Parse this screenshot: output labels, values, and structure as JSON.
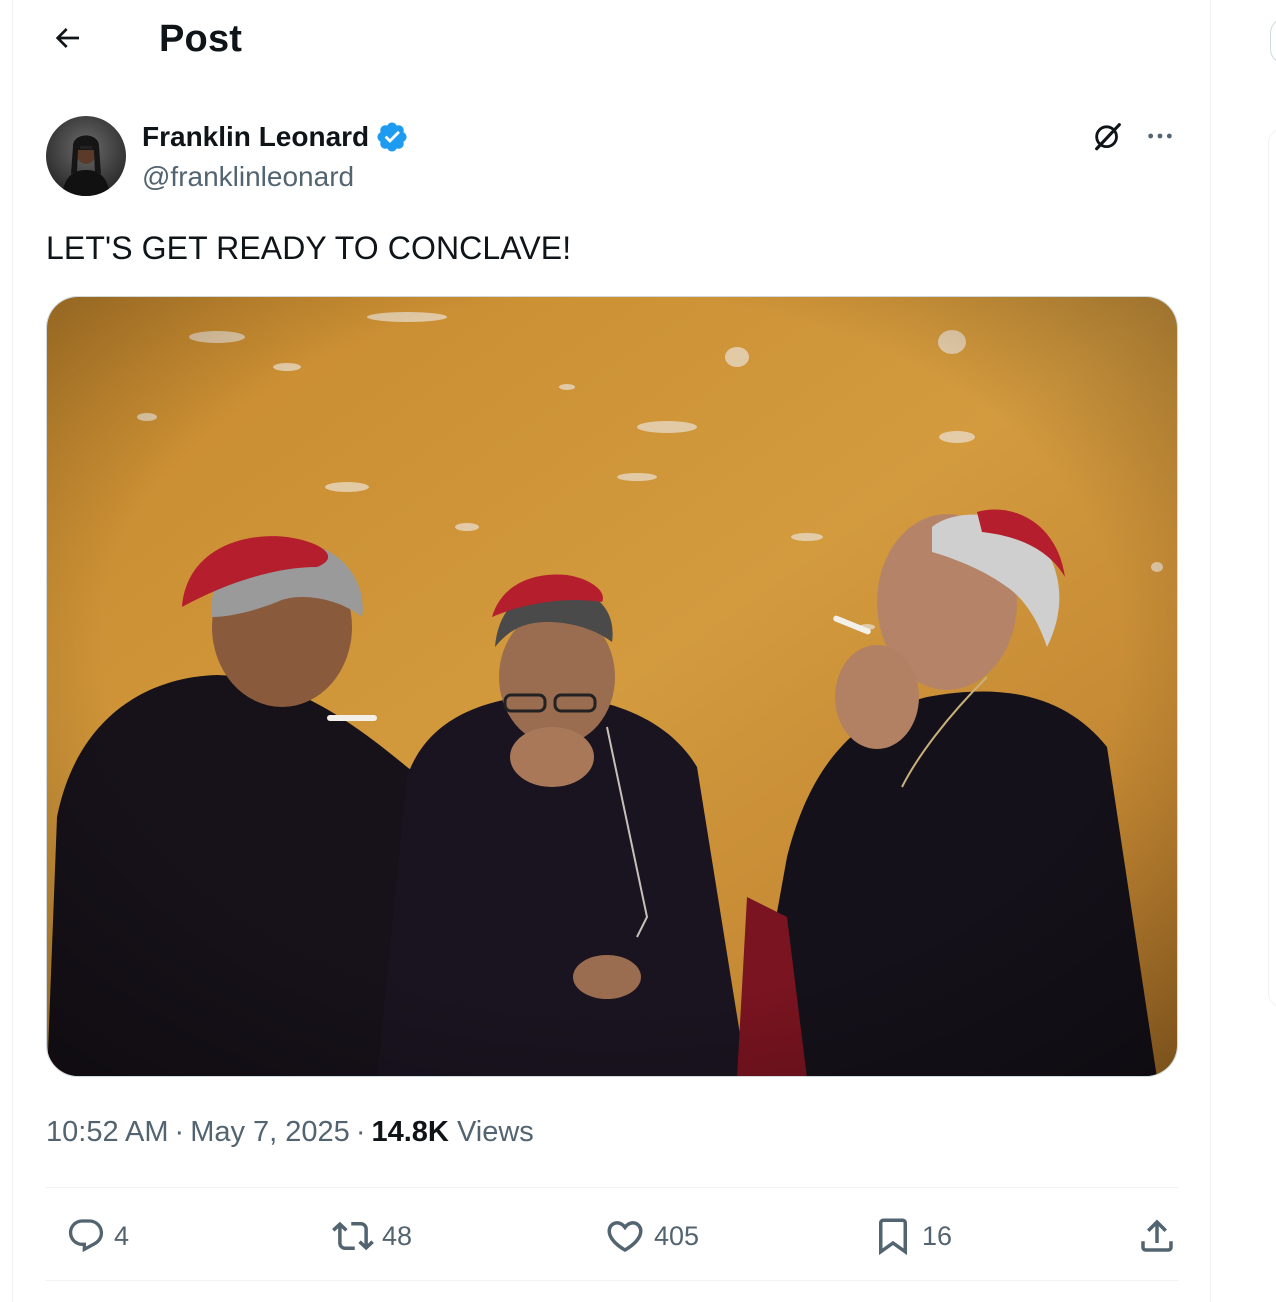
{
  "header": {
    "title": "Post",
    "back_icon": "arrow-left-icon"
  },
  "author": {
    "display_name": "Franklin Leonard",
    "handle": "@franklinleonard",
    "verified": true,
    "verified_color": "#1d9bf0"
  },
  "post": {
    "text": "LET'S GET READY TO CONCLAVE!",
    "image_description_icon": "photo"
  },
  "meta": {
    "time": "10:52 AM",
    "date": "May 7, 2025",
    "separator": "·",
    "views_count": "14.8K",
    "views_label": "Views"
  },
  "actions": {
    "replies": "4",
    "reposts": "48",
    "likes": "405",
    "bookmarks": "16"
  },
  "colors": {
    "text_primary": "#0f1419",
    "text_secondary": "#536471",
    "border": "#eff3f4",
    "accent": "#1d9bf0"
  }
}
